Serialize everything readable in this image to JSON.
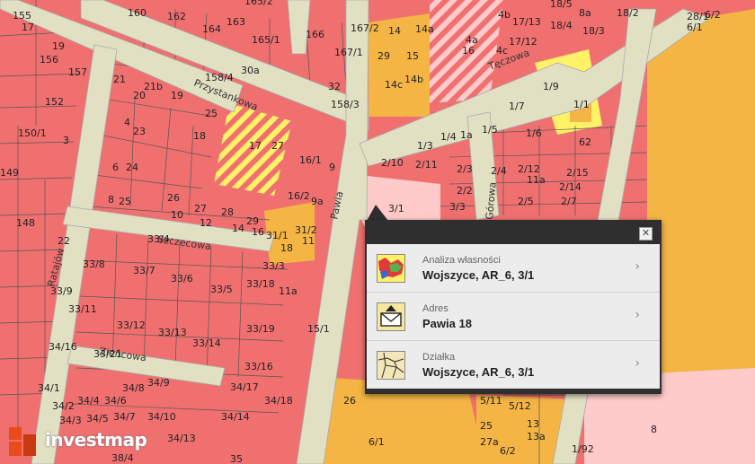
{
  "map": {
    "streets": [
      "Przystankowa",
      "Pawia",
      "Szczecowa",
      "Tęczowa",
      "Ratajów",
      "Zieńcowa",
      "Górowa"
    ],
    "parcels": [
      "155",
      "17",
      "160",
      "162",
      "164",
      "163",
      "165/2",
      "165/1",
      "166",
      "167/2",
      "167/1",
      "14",
      "14a",
      "4b",
      "17/13",
      "18/5",
      "8a",
      "18/4",
      "18/3",
      "18/2",
      "6/2",
      "6/1",
      "28/1",
      "156",
      "19",
      "157",
      "21",
      "21b",
      "20",
      "19",
      "30a",
      "32",
      "158/3",
      "158/4",
      "152",
      "150/1",
      "3",
      "4",
      "23",
      "25",
      "18",
      "17",
      "27",
      "16/1",
      "9",
      "2/10",
      "2/11",
      "1/4",
      "1a",
      "1/3",
      "1/5",
      "1/7",
      "1/6",
      "1/9",
      "1/1",
      "62",
      "149",
      "6",
      "24",
      "8",
      "25",
      "26",
      "10",
      "27",
      "12",
      "28",
      "14",
      "29",
      "16",
      "16/2",
      "9a",
      "31/1",
      "31/2",
      "18",
      "11",
      "2/3",
      "2/4",
      "2/12",
      "2/15",
      "2/2",
      "2/14",
      "2/5",
      "2/7",
      "3/1",
      "3/3",
      "11a",
      "148",
      "22",
      "33/4",
      "33/8",
      "33/7",
      "33/6",
      "33/5",
      "33/3",
      "33/18",
      "11a",
      "33/9",
      "33/11",
      "33/12",
      "33/13",
      "33/14",
      "33/19",
      "15/1",
      "34/16",
      "33/21",
      "33/16",
      "34/17",
      "34/18",
      "34/14",
      "34/1",
      "34/2",
      "34/3",
      "34/4",
      "34/5",
      "34/6",
      "34/7",
      "34/8",
      "34/9",
      "34/10",
      "34/13",
      "26",
      "6/1",
      "5/11",
      "5/12",
      "25",
      "27a",
      "6/2",
      "13",
      "13a",
      "1/92",
      "8",
      "35",
      "38/4",
      "14c",
      "14b",
      "4a",
      "16",
      "4c",
      "17/12",
      "15",
      "29"
    ],
    "accent_colors": {
      "residential": "#f07070",
      "commercial": "#f4b544",
      "road": "#e2e0c2",
      "highlight": "#fff266",
      "plan": "#ffcaca"
    }
  },
  "popup": {
    "close_symbol": "✕",
    "items": [
      {
        "label": "Analiza własności",
        "value": "Wojszyce, AR_6, 3/1",
        "icon": "ownership-map-icon"
      },
      {
        "label": "Adres",
        "value": "Pawia 18",
        "icon": "address-envelope-icon"
      },
      {
        "label": "Działka",
        "value": "Wojszyce, AR_6, 3/1",
        "icon": "parcel-map-icon"
      }
    ],
    "chevron": "›"
  },
  "logo": {
    "text": "investmap"
  }
}
